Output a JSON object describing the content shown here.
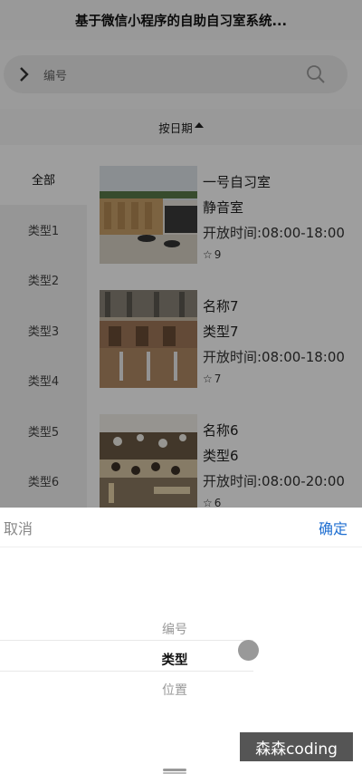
{
  "app": {
    "title": "基于微信小程序的自助自习室系统..."
  },
  "search": {
    "field_label": "编号"
  },
  "sort": {
    "label": "按日期"
  },
  "sidebar": {
    "items": [
      {
        "label": "全部"
      },
      {
        "label": "类型1"
      },
      {
        "label": "类型2"
      },
      {
        "label": "类型3"
      },
      {
        "label": "类型4"
      },
      {
        "label": "类型5"
      },
      {
        "label": "类型6"
      }
    ]
  },
  "rooms": [
    {
      "name": "一号自习室",
      "type": "静音室",
      "hours": "开放时间:08:00-18:00",
      "stars": "9"
    },
    {
      "name": "名称7",
      "type": "类型7",
      "hours": "开放时间:08:00-18:00",
      "stars": "7"
    },
    {
      "name": "名称6",
      "type": "类型6",
      "hours": "开放时间:08:00-20:00",
      "stars": "6"
    }
  ],
  "picker": {
    "cancel_label": "取消",
    "confirm_label": "确定",
    "options": [
      {
        "label": "编号"
      },
      {
        "label": "类型"
      },
      {
        "label": "位置"
      }
    ],
    "selected": "类型"
  },
  "watermark": "森森coding",
  "colors": {
    "confirm": "#1f6fd1",
    "overlay": "rgba(0,0,0,0.38)"
  }
}
